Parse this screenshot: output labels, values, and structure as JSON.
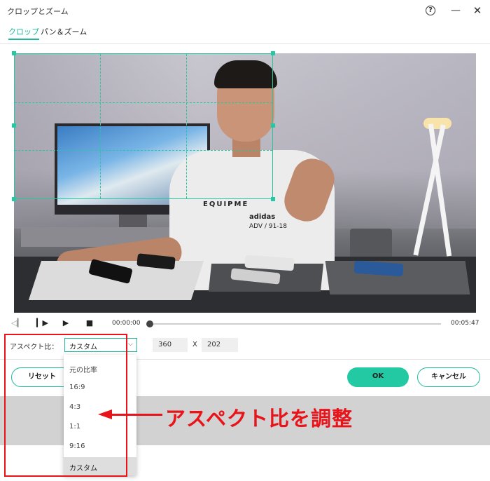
{
  "window": {
    "title": "クロップとズーム",
    "help_icon": "question-circle-icon",
    "minimize_icon": "minimize-icon",
    "close_icon": "close-icon"
  },
  "tabs": [
    {
      "label": "クロップ",
      "active": true
    },
    {
      "label": "パン＆ズーム",
      "active": false
    }
  ],
  "video": {
    "shirt_text_1": "EQUIPME",
    "shirt_text_2": "adidas",
    "shirt_text_3": "ADV / 91-18"
  },
  "player": {
    "current_time": "00:00:00",
    "duration": "00:05:47",
    "progress": 0,
    "icons": [
      "prev-frame-icon",
      "step-forward-icon",
      "play-icon",
      "stop-icon"
    ]
  },
  "aspect": {
    "label": "アスペクト比：",
    "selected": "カスタム",
    "width": "360",
    "times": "X",
    "height": "202",
    "options": [
      "元の比率",
      "16:9",
      "4:3",
      "1:1",
      "9:16",
      "カスタム"
    ]
  },
  "buttons": {
    "reset": "リセット",
    "ok": "OK",
    "cancel": "キャンセル"
  },
  "annotation": {
    "text": "アスペクト比を調整"
  },
  "colors": {
    "accent": "#22c9a3",
    "annotation_red": "#e8141a"
  }
}
